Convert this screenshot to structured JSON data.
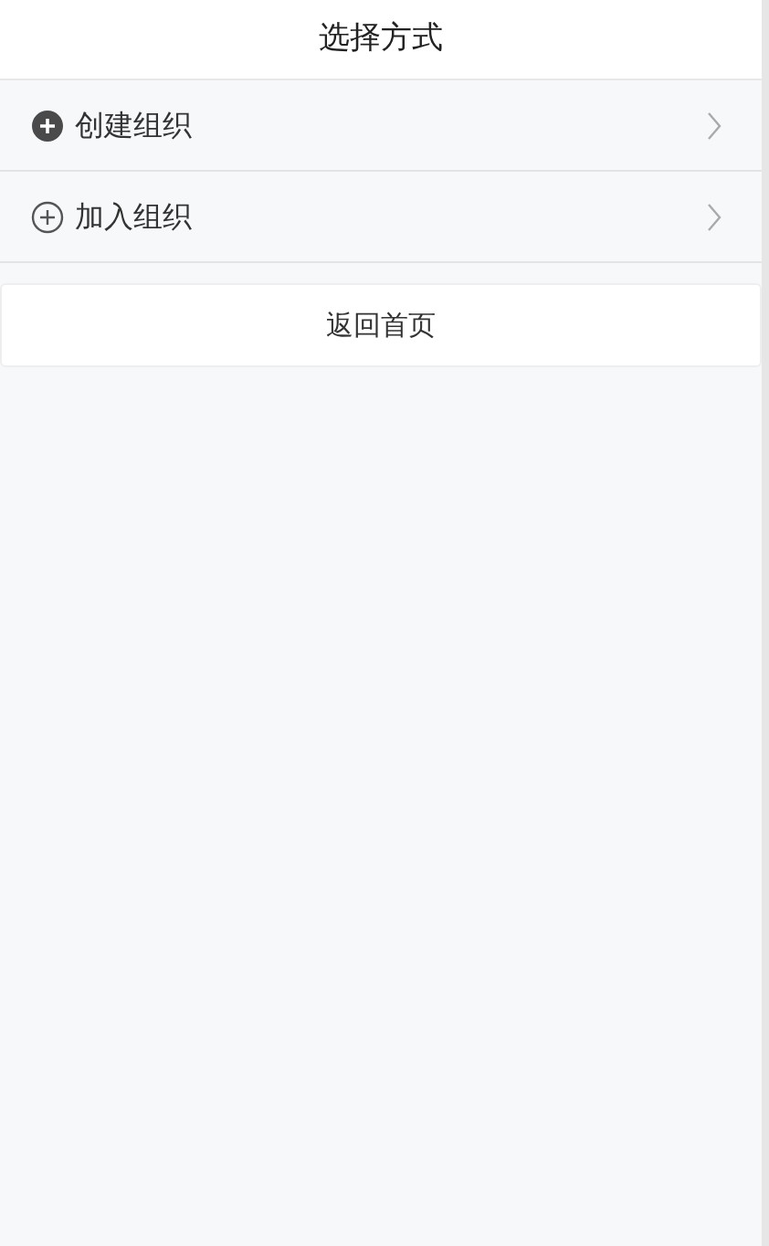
{
  "header": {
    "title": "选择方式"
  },
  "options": [
    {
      "label": "创建组织",
      "kind": "filled"
    },
    {
      "label": "加入组织",
      "kind": "outline"
    }
  ],
  "back_button": {
    "label": "返回首页"
  }
}
